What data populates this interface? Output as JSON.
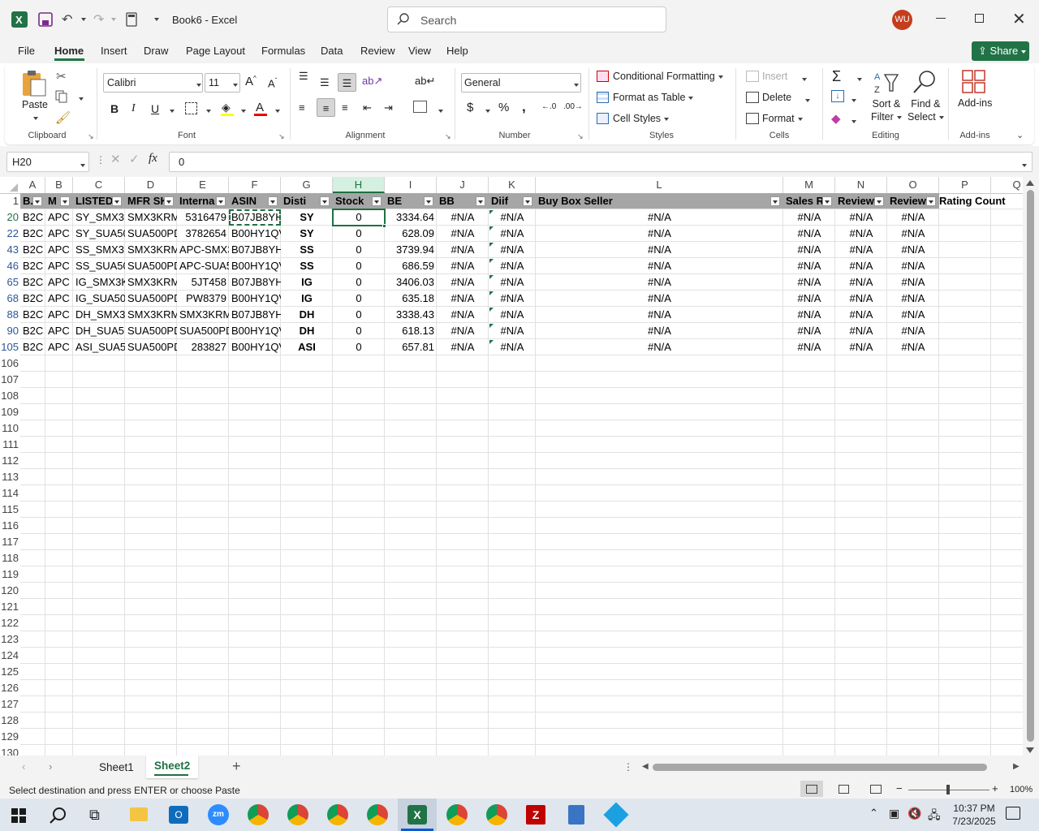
{
  "window": {
    "title": "Book6  -  Excel",
    "search_placeholder": "Search",
    "user_initials": "WU"
  },
  "menu": {
    "tabs": [
      "File",
      "Home",
      "Insert",
      "Draw",
      "Page Layout",
      "Formulas",
      "Data",
      "Review",
      "View",
      "Help"
    ],
    "active": "Home",
    "share_label": "Share"
  },
  "ribbon": {
    "clipboard": {
      "paste": "Paste",
      "group": "Clipboard"
    },
    "font": {
      "name": "Calibri",
      "size": "11",
      "group": "Font"
    },
    "alignment": {
      "group": "Alignment"
    },
    "number": {
      "format": "General",
      "group": "Number"
    },
    "styles": {
      "conditional": "Conditional Formatting",
      "format_table": "Format as Table",
      "cell_styles": "Cell Styles",
      "group": "Styles"
    },
    "cells": {
      "insert": "Insert",
      "delete": "Delete",
      "format": "Format",
      "group": "Cells"
    },
    "editing": {
      "sort1": "Sort &",
      "sort2": "Filter",
      "find1": "Find &",
      "find2": "Select",
      "group": "Editing"
    },
    "addins": {
      "label": "Add-ins",
      "group": "Add-ins"
    }
  },
  "formula_bar": {
    "name_box": "H20",
    "fx": "fx",
    "value": "0"
  },
  "columns": [
    "A",
    "B",
    "C",
    "D",
    "E",
    "F",
    "G",
    "H",
    "I",
    "J",
    "K",
    "L",
    "M",
    "N",
    "O",
    "P",
    "Q"
  ],
  "header_row": {
    "num": "1",
    "cells": [
      "B.",
      "M",
      "LISTED",
      "MFR SK",
      "Interna",
      "ASIN",
      "Disti",
      "Stock",
      "BE",
      "BB",
      "Diif",
      "Buy Box Seller",
      "Sales R",
      "Review",
      "Review",
      "Rating Count"
    ]
  },
  "rows": [
    {
      "num": "20",
      "cells": [
        "B2C",
        "APC",
        "SY_SMX3K",
        "SMX3KRM",
        "5316479",
        "B07JB8YH",
        "SY",
        "0",
        "3334.64",
        "#N/A",
        "#N/A",
        "#N/A",
        "#N/A",
        "#N/A",
        "#N/A"
      ]
    },
    {
      "num": "22",
      "cells": [
        "B2C",
        "APC",
        "SY_SUA50",
        "SUA500PD",
        "3782654",
        "B00HY1QV",
        "SY",
        "0",
        "628.09",
        "#N/A",
        "#N/A",
        "#N/A",
        "#N/A",
        "#N/A",
        "#N/A"
      ]
    },
    {
      "num": "43",
      "cells": [
        "B2C",
        "APC",
        "SS_SMX3K",
        "SMX3KRM",
        "APC-SMX3",
        "B07JB8YH",
        "SS",
        "0",
        "3739.94",
        "#N/A",
        "#N/A",
        "#N/A",
        "#N/A",
        "#N/A",
        "#N/A"
      ]
    },
    {
      "num": "46",
      "cells": [
        "B2C",
        "APC",
        "SS_SUA50",
        "SUA500PD",
        "APC-SUA5",
        "B00HY1QV",
        "SS",
        "0",
        "686.59",
        "#N/A",
        "#N/A",
        "#N/A",
        "#N/A",
        "#N/A",
        "#N/A"
      ]
    },
    {
      "num": "65",
      "cells": [
        "B2C",
        "APC",
        "IG_SMX3K",
        "SMX3KRM",
        "5JT458",
        "B07JB8YH",
        "IG",
        "0",
        "3406.03",
        "#N/A",
        "#N/A",
        "#N/A",
        "#N/A",
        "#N/A",
        "#N/A"
      ]
    },
    {
      "num": "68",
      "cells": [
        "B2C",
        "APC",
        "IG_SUA50",
        "SUA500PD",
        "PW8379",
        "B00HY1QV",
        "IG",
        "0",
        "635.18",
        "#N/A",
        "#N/A",
        "#N/A",
        "#N/A",
        "#N/A",
        "#N/A"
      ]
    },
    {
      "num": "88",
      "cells": [
        "B2C",
        "APC",
        "DH_SMX3",
        "SMX3KRM",
        "SMX3KRM",
        "B07JB8YH",
        "DH",
        "0",
        "3338.43",
        "#N/A",
        "#N/A",
        "#N/A",
        "#N/A",
        "#N/A",
        "#N/A"
      ]
    },
    {
      "num": "90",
      "cells": [
        "B2C",
        "APC",
        "DH_SUA5",
        "SUA500PD",
        "SUA500PD",
        "B00HY1QV",
        "DH",
        "0",
        "618.13",
        "#N/A",
        "#N/A",
        "#N/A",
        "#N/A",
        "#N/A",
        "#N/A"
      ]
    },
    {
      "num": "105",
      "cells": [
        "B2C",
        "APC",
        "ASI_SUA5",
        "SUA500PD",
        "283827",
        "B00HY1QV",
        "ASI",
        "0",
        "657.81",
        "#N/A",
        "#N/A",
        "#N/A",
        "#N/A",
        "#N/A",
        "#N/A"
      ]
    }
  ],
  "empty_rows": [
    "106",
    "107",
    "108",
    "109",
    "110",
    "111",
    "112",
    "113",
    "114",
    "115",
    "116",
    "117",
    "118",
    "119",
    "120",
    "121",
    "122",
    "123",
    "124",
    "125",
    "126",
    "127",
    "128",
    "129",
    "130"
  ],
  "sheets": {
    "tabs": [
      "Sheet1",
      "Sheet2"
    ],
    "active": "Sheet2"
  },
  "status": {
    "message": "Select destination and press ENTER or choose Paste",
    "zoom": "100%"
  },
  "taskbar": {
    "time": "10:37 PM",
    "date": "7/23/2025"
  },
  "colors": {
    "excel_green": "#217346",
    "header_fill": "#a6a6a6",
    "accent": "#1e7145"
  }
}
